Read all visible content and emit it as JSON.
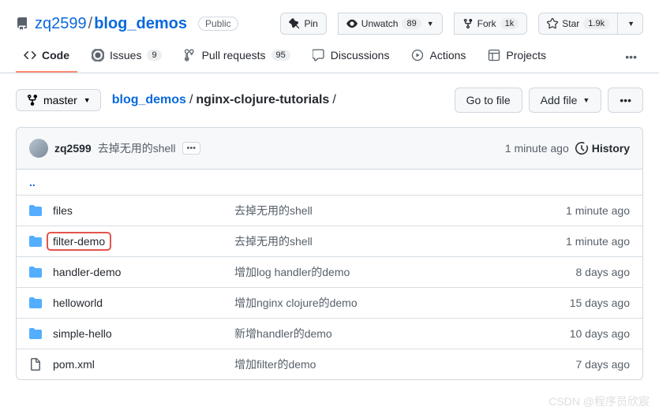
{
  "header": {
    "owner": "zq2599",
    "repo": "blog_demos",
    "visibility": "Public",
    "pin": "Pin",
    "unwatch": "Unwatch",
    "watch_count": "89",
    "fork": "Fork",
    "fork_count": "1k",
    "star": "Star",
    "star_count": "1.9k"
  },
  "tabs": {
    "code": "Code",
    "issues": "Issues",
    "issues_count": "9",
    "pulls": "Pull requests",
    "pulls_count": "95",
    "discussions": "Discussions",
    "actions": "Actions",
    "projects": "Projects"
  },
  "toolbar": {
    "branch": "master",
    "root": "blog_demos",
    "path": "nginx-clojure-tutorials",
    "goto": "Go to file",
    "addfile": "Add file"
  },
  "commit": {
    "author": "zq2599",
    "message": "去掉无用的shell",
    "ago": "1 minute ago",
    "history": "History"
  },
  "updir": "..",
  "files": [
    {
      "type": "dir",
      "name": "files",
      "msg": "去掉无用的shell",
      "time": "1 minute ago",
      "hl": false
    },
    {
      "type": "dir",
      "name": "filter-demo",
      "msg": "去掉无用的shell",
      "time": "1 minute ago",
      "hl": true
    },
    {
      "type": "dir",
      "name": "handler-demo",
      "msg": "增加log handler的demo",
      "time": "8 days ago",
      "hl": false
    },
    {
      "type": "dir",
      "name": "helloworld",
      "msg": "增加nginx clojure的demo",
      "time": "15 days ago",
      "hl": false
    },
    {
      "type": "dir",
      "name": "simple-hello",
      "msg": "新增handler的demo",
      "time": "10 days ago",
      "hl": false
    },
    {
      "type": "file",
      "name": "pom.xml",
      "msg": "增加filter的demo",
      "time": "7 days ago",
      "hl": false
    }
  ],
  "watermark": "CSDN @程序员欣宸"
}
